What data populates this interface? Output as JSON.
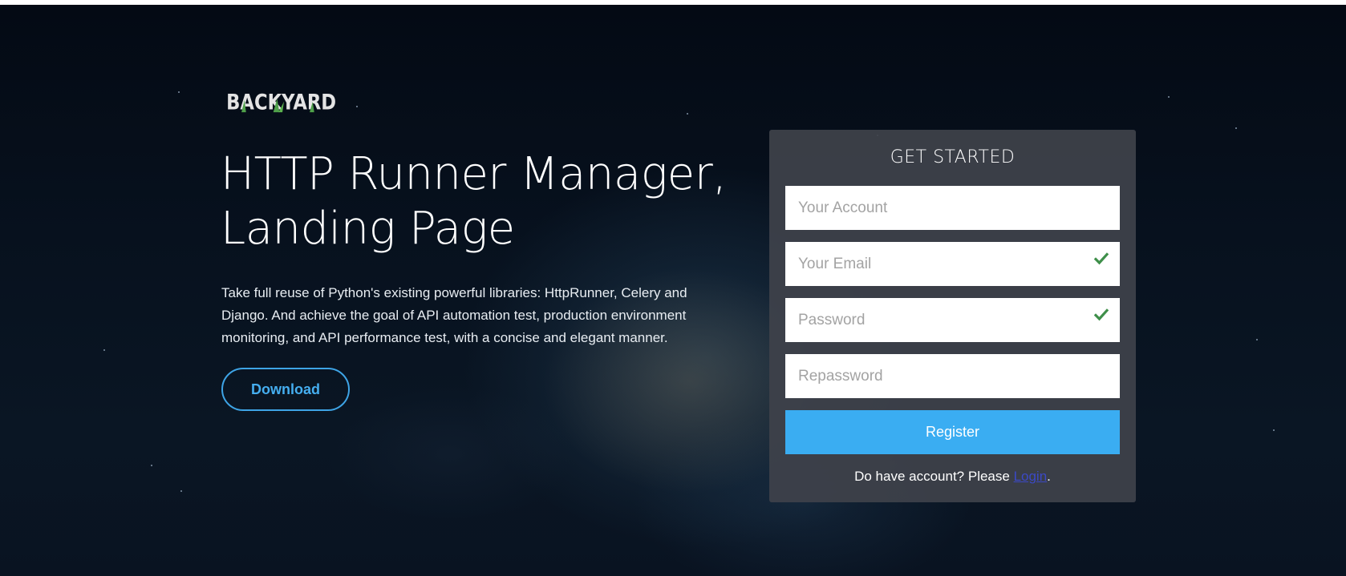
{
  "brand": {
    "logo_text": "BACKYARD"
  },
  "hero": {
    "headline_line1": "HTTP Runner Manager,",
    "headline_line2": "Landing Page",
    "description": "Take full reuse of Python's existing powerful libraries: HttpRunner, Celery and Django. And achieve the goal of API automation test, production environment monitoring, and API performance test, with a concise and elegant manner.",
    "download_label": "Download"
  },
  "form": {
    "title": "GET STARTED",
    "account_placeholder": "Your Account",
    "email_placeholder": "Your Email",
    "password_placeholder": "Password",
    "repassword_placeholder": "Repassword",
    "register_label": "Register",
    "login_prompt": "Do have account? Please ",
    "login_link": "Login",
    "login_suffix": "."
  },
  "colors": {
    "accent": "#3aadf2",
    "check_green": "#3f8f4a",
    "background_dark": "#07111e",
    "panel": "#3e424a"
  },
  "icons": {
    "email_status": "check-icon",
    "password_status": "check-icon"
  }
}
